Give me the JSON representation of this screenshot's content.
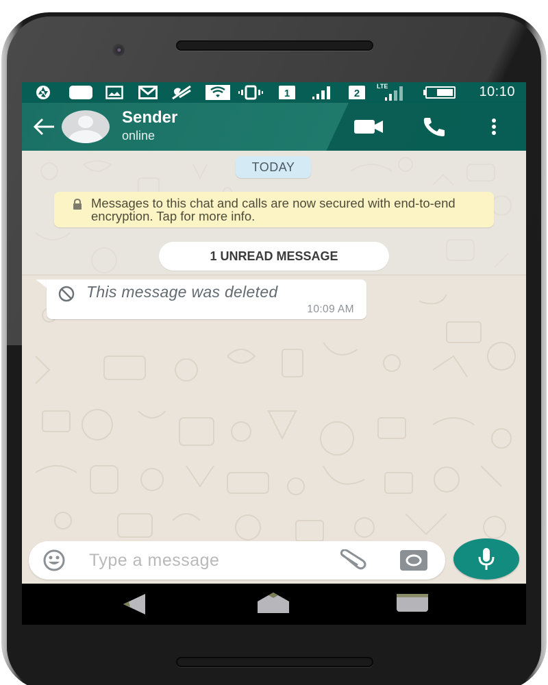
{
  "status_bar": {
    "icons": [
      "aperture-icon",
      "notification-square-icon",
      "image-icon",
      "gmail-icon",
      "mute-icon",
      "wifi-icon",
      "vibrate-icon",
      "sim1-icon",
      "signal1-icon",
      "sim2-icon",
      "signal2-lte-icon",
      "battery-icon"
    ],
    "sim1_label": "1",
    "sim2_label": "2",
    "network_type": "LTE",
    "time": "10:10"
  },
  "header": {
    "contact_name": "Sender",
    "contact_status": "online",
    "actions": [
      "video-call",
      "voice-call",
      "more-options"
    ]
  },
  "colors": {
    "header": "#075e54",
    "accent": "#128c7e",
    "chat_bg": "#ebe4da",
    "encryption_notice_bg": "#fcf4c4",
    "date_chip_bg": "#d4eaf4"
  },
  "chat": {
    "date_label": "TODAY",
    "encryption_notice": "Messages to this chat and calls are now secured with end-to-end encryption. Tap for more info.",
    "unread_label": "1 UNREAD MESSAGE",
    "messages": [
      {
        "direction": "incoming",
        "text": "This message was deleted",
        "deleted": true,
        "time": "10:09 AM"
      }
    ]
  },
  "composer": {
    "placeholder": "Type a message",
    "value": ""
  },
  "nav_bar": {
    "buttons": [
      "back",
      "home",
      "recents"
    ]
  }
}
